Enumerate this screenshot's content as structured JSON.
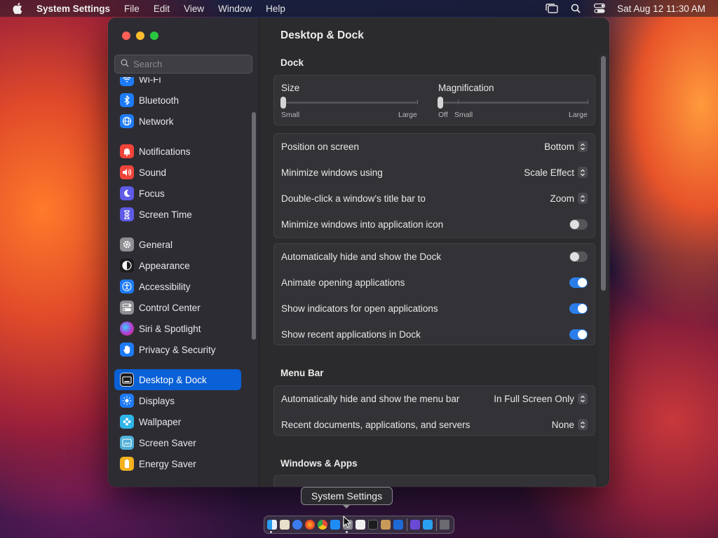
{
  "menubar": {
    "app_name": "System Settings",
    "items": [
      "File",
      "Edit",
      "View",
      "Window",
      "Help"
    ],
    "clock": "Sat Aug 12  11:30 AM"
  },
  "search": {
    "placeholder": "Search"
  },
  "sidebar": {
    "items": [
      {
        "label": "Wi-Fi",
        "icon": "wifi-icon",
        "color": "#1e7bf5"
      },
      {
        "label": "Bluetooth",
        "icon": "bluetooth-icon",
        "color": "#1e7bf5"
      },
      {
        "label": "Network",
        "icon": "globe-icon",
        "color": "#1e7bf5"
      },
      {
        "label": "Notifications",
        "icon": "bell-icon",
        "color": "#f0443a"
      },
      {
        "label": "Sound",
        "icon": "speaker-icon",
        "color": "#f0443a"
      },
      {
        "label": "Focus",
        "icon": "moon-icon",
        "color": "#5e5ce6"
      },
      {
        "label": "Screen Time",
        "icon": "hourglass-icon",
        "color": "#5e5ce6"
      },
      {
        "label": "General",
        "icon": "gear-icon",
        "color": "#8e8e93"
      },
      {
        "label": "Appearance",
        "icon": "appearance-icon",
        "color": "#1c1c1e"
      },
      {
        "label": "Accessibility",
        "icon": "accessibility-icon",
        "color": "#1e7bf5"
      },
      {
        "label": "Control Center",
        "icon": "control-center-icon",
        "color": "#8e8e93"
      },
      {
        "label": "Siri & Spotlight",
        "icon": "siri-icon",
        "color": "#b03ad6"
      },
      {
        "label": "Privacy & Security",
        "icon": "hand-icon",
        "color": "#1e7bf5"
      },
      {
        "label": "Desktop & Dock",
        "icon": "desktop-icon",
        "color": "#1c1c1e"
      },
      {
        "label": "Displays",
        "icon": "sun-icon",
        "color": "#1e7bf5"
      },
      {
        "label": "Wallpaper",
        "icon": "wallpaper-icon",
        "color": "#2fb5e8"
      },
      {
        "label": "Screen Saver",
        "icon": "screen-saver-icon",
        "color": "#4fb0d8"
      },
      {
        "label": "Energy Saver",
        "icon": "battery-icon",
        "color": "#f5b21e"
      }
    ],
    "active": "Desktop & Dock"
  },
  "content": {
    "title": "Desktop & Dock",
    "dock_section": {
      "title": "Dock",
      "size": {
        "label": "Size",
        "min_label": "Small",
        "max_label": "Large",
        "value": 0.0
      },
      "magnification": {
        "label": "Magnification",
        "off_label": "Off",
        "min_label": "Small",
        "max_label": "Large",
        "value": 0.0
      },
      "popups": [
        {
          "label": "Position on screen",
          "value": "Bottom"
        },
        {
          "label": "Minimize windows using",
          "value": "Scale Effect"
        },
        {
          "label": "Double-click a window's title bar to",
          "value": "Zoom"
        }
      ],
      "minimize_into_icon": {
        "label": "Minimize windows into application icon",
        "on": false
      },
      "toggles": [
        {
          "label": "Automatically hide and show the Dock",
          "on": false
        },
        {
          "label": "Animate opening applications",
          "on": true
        },
        {
          "label": "Show indicators for open applications",
          "on": true
        },
        {
          "label": "Show recent applications in Dock",
          "on": true
        }
      ]
    },
    "menubar_section": {
      "title": "Menu Bar",
      "rows": [
        {
          "label": "Automatically hide and show the menu bar",
          "value": "In Full Screen Only"
        },
        {
          "label": "Recent documents, applications, and servers",
          "value": "None"
        }
      ]
    },
    "windows_section": {
      "title": "Windows & Apps"
    }
  },
  "tooltip": "System Settings",
  "accent_color": "#0a60d6"
}
